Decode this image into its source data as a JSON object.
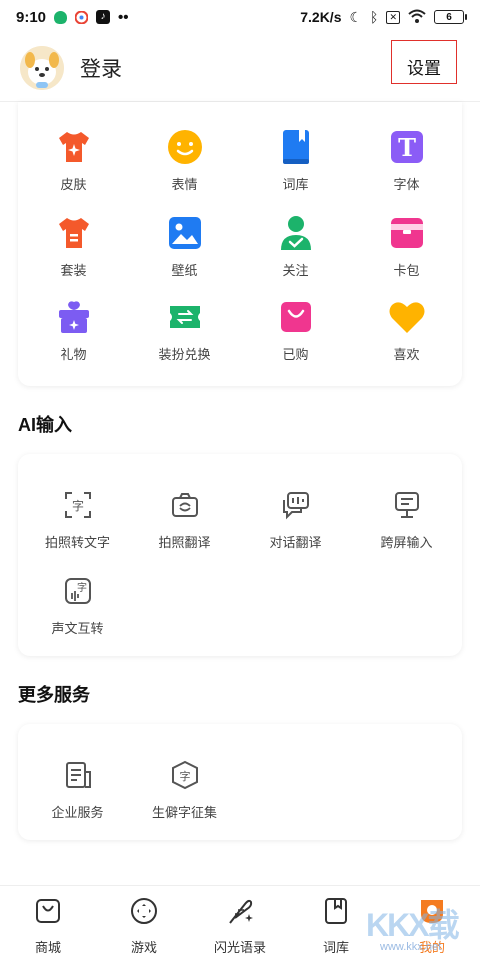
{
  "status_bar": {
    "time": "9:10",
    "network_speed": "7.2K/s",
    "battery": "6",
    "dots": "••"
  },
  "header": {
    "login_label": "登录",
    "settings_label": "设置"
  },
  "skin_grid": {
    "items": [
      {
        "label": "皮肤",
        "icon": "tshirt-sparkle-icon",
        "color": "#f4592b"
      },
      {
        "label": "表情",
        "icon": "smiley-icon",
        "color": "#ffb300"
      },
      {
        "label": "词库",
        "icon": "book-icon",
        "color": "#1f7bf2"
      },
      {
        "label": "字体",
        "icon": "letter-t-icon",
        "color": "#8b5cf6"
      },
      {
        "label": "套装",
        "icon": "tshirt-icon",
        "color": "#f4592b"
      },
      {
        "label": "壁纸",
        "icon": "picture-icon",
        "color": "#1f7bf2"
      },
      {
        "label": "关注",
        "icon": "user-check-icon",
        "color": "#1cb36b"
      },
      {
        "label": "卡包",
        "icon": "wallet-icon",
        "color": "#f0368f"
      },
      {
        "label": "礼物",
        "icon": "gift-icon",
        "color": "#7c5cf2"
      },
      {
        "label": "装扮兑换",
        "icon": "exchange-ticket-icon",
        "color": "#1cb36b"
      },
      {
        "label": "已购",
        "icon": "shopping-bag-icon",
        "color": "#f0368f"
      },
      {
        "label": "喜欢",
        "icon": "heart-icon",
        "color": "#ffb300"
      }
    ]
  },
  "ai_section": {
    "title": "AI输入",
    "items": [
      {
        "label": "拍照转文字",
        "icon": "photo-to-text-icon"
      },
      {
        "label": "拍照翻译",
        "icon": "photo-translate-icon"
      },
      {
        "label": "对话翻译",
        "icon": "dialog-translate-icon"
      },
      {
        "label": "跨屏输入",
        "icon": "cross-screen-input-icon"
      },
      {
        "label": "声文互转",
        "icon": "voice-text-convert-icon"
      }
    ]
  },
  "more_section": {
    "title": "更多服务",
    "items": [
      {
        "label": "企业服务",
        "icon": "enterprise-document-icon"
      },
      {
        "label": "生僻字征集",
        "icon": "rare-character-icon"
      }
    ]
  },
  "bottom_nav": {
    "items": [
      {
        "label": "商城",
        "icon": "shop-bag-icon"
      },
      {
        "label": "游戏",
        "icon": "gamepad-icon"
      },
      {
        "label": "闪光语录",
        "icon": "feather-sparkle-icon"
      },
      {
        "label": "词库",
        "icon": "bookmark-book-icon"
      },
      {
        "label": "我的",
        "icon": "profile-icon",
        "active": true
      }
    ],
    "active_color": "#f47b20"
  },
  "watermark": {
    "text": "KKX载",
    "url": "www.kkx.net"
  }
}
